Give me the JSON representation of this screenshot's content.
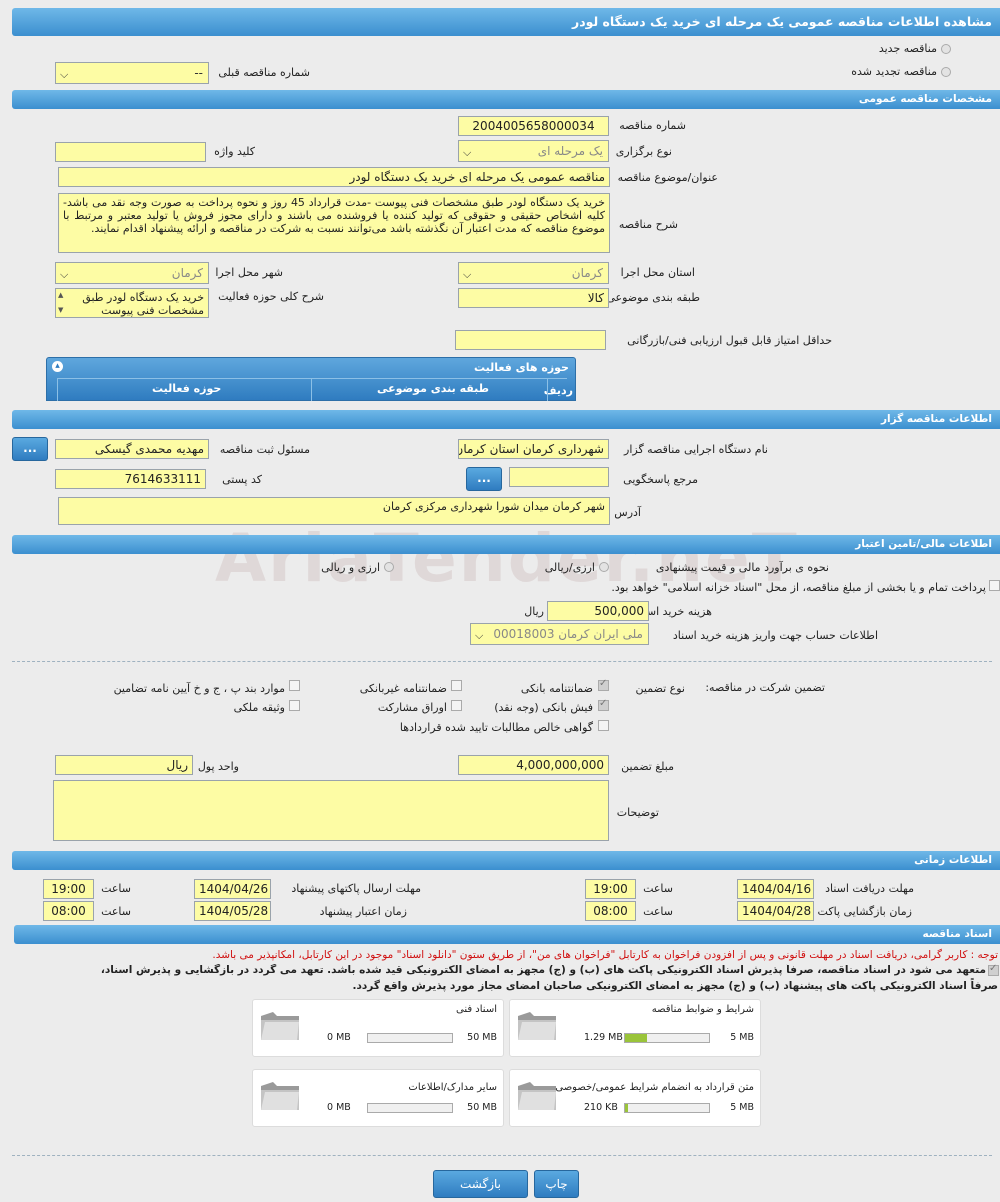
{
  "page": {
    "title": "مشاهده اطلاعات مناقصه عمومی یک مرحله ای خرید یک دستگاه لودر"
  },
  "top": {
    "new_tender": "مناقصه جدید",
    "renewed_tender": "مناقصه تجدید شده",
    "prev_number_label": "شماره مناقصه قبلی",
    "prev_number_value": "--"
  },
  "general": {
    "section": "مشخصات مناقصه عمومی",
    "number_label": "شماره مناقصه",
    "number_value": "2004005658000034",
    "type_label": "نوع برگزاری",
    "type_value": "یک مرحله ای",
    "keyword_label": "کلید واژه",
    "keyword_value": "",
    "subject_label": "عنوان/موضوع مناقصه",
    "subject_value": "مناقصه عمومی یک مرحله ای خرید یک دستگاه لودر",
    "desc_label": "شرح مناقصه",
    "desc_value": "خرید یک دستگاه لودر طبق مشخصات فنی پیوست -مدت قرارداد  45 روز  و نحوه پرداخت به صورت وجه نقد می باشد-کلیه اشخاص حقیقی و حقوقی که تولید کننده یا فروشنده می باشند و دارای مجوز فروش یا تولید معتبر و مرتبط با موضوع مناقصه که مدت اعتبار آن نگذشته باشد می‌توانند نسبت به شرکت در مناقصه و ارائه پیشنهاد اقدام نمایند.",
    "province_label": "استان محل اجرا",
    "province_value": "کرمان",
    "city_label": "شهر محل اجرا",
    "city_value": "کرمان",
    "category_label": "طبقه بندی موضوعی",
    "category_value": "کالا",
    "activity_desc_label": "شرح کلی حوزه فعالیت",
    "activity_desc_value": "خرید یک دستگاه لودر طبق مشخصات فنی پیوست",
    "min_score_label": "حداقل امتیاز قابل قبول ارزیابی فنی/بازرگانی",
    "min_score_value": ""
  },
  "activities": {
    "title": "حوزه های فعالیت",
    "col_row": "ردیف",
    "col_category": "طبقه بندی موضوعی",
    "col_activity": "حوزه فعالیت"
  },
  "organizer": {
    "section": "اطلاعات مناقصه گزار",
    "org_label": "نام دستگاه اجرایی مناقصه گزار",
    "org_value": "شهرداری کرمان استان کرمان",
    "resp_label": "مسئول ثبت مناقصه",
    "resp_value": "مهدیه محمدی گیسکی",
    "ref_label": "مرجع پاسخگویی",
    "ref_value": "",
    "postal_label": "کد پستی",
    "postal_value": "7614633111",
    "address_label": "آدرس",
    "address_value": "شهر کرمان میدان شورا شهرداری مرکزی کرمان",
    "dots": "..."
  },
  "financial": {
    "section": "اطلاعات مالی/تامین اعتبار",
    "estimate_label": "نحوه ی برآورد مالی و قیمت پیشنهادی",
    "opt_currency": "ارزی/ریالی",
    "opt_rial": "ارزی و ریالی",
    "treasury_label": "پرداخت تمام و یا بخشی از مبلغ مناقصه، از محل \"اسناد خزانه اسلامی\" خواهد بود.",
    "doc_cost_label": "هزینه خرید اسناد",
    "doc_cost_value": "500,000",
    "doc_cost_unit": "ریال",
    "account_label": "اطلاعات حساب جهت واریز هزینه خرید اسناد",
    "account_value": "ملی ایران کرمان 00018003"
  },
  "guarantee": {
    "title": "تضمین شرکت در مناقصه:",
    "type_label": "نوع تضمین",
    "bank": "ضمانتنامه بانکی",
    "nonbank": "ضمانتنامه غیربانکی",
    "clauses": "موارد بند پ ، ج و خ آیین نامه تضامین",
    "cash": "فیش بانکی (وجه نقد)",
    "bonds": "اوراق مشارکت",
    "property": "وثیقه ملکی",
    "claims": "گواهی خالص مطالبات تایید شده قراردادها",
    "amount_label": "مبلغ تضمین",
    "amount_value": "4,000,000,000",
    "unit_label": "واحد پول",
    "unit_value": "ریال",
    "notes_label": "توضیحات",
    "notes_value": ""
  },
  "timing": {
    "section": "اطلاعات زمانی",
    "receive_label": "مهلت دریافت اسناد",
    "receive_date": "1404/04/16",
    "receive_time": "19:00",
    "send_label": "مهلت ارسال پاکتهای پیشنهاد",
    "send_date": "1404/04/26",
    "send_time": "19:00",
    "open_label": "زمان بازگشایی پاکت ها",
    "open_date": "1404/04/28",
    "open_time": "08:00",
    "validity_label": "زمان اعتبار پیشنهاد",
    "validity_date": "1404/05/28",
    "validity_time": "08:00",
    "time_label": "ساعت"
  },
  "docs": {
    "section": "اسناد مناقصه",
    "warning": "توجه : کاربر گرامی، دریافت اسناد در مهلت قانونی و پس از افزودن فراخوان به کارتابل \"فراخوان های من\"، از طریق ستون \"دانلود اسناد\" موجود در این کارتابل، امکانپذیر می باشد.",
    "commit_line1": "متعهد می شود در اسناد مناقصه، صرفاً پذیرش اسناد الکترونیکی پاکت های (ب) و (ج) مجهز به امضای الکترونیکی قید شده باشد. تعهد می گردد در بازگشایی و پذیرش اسناد،",
    "commit_line2": "صرفاً اسناد الکترونیکی پاکت های پیشنهاد (ب) و (ج) مجهز به امضای الکترونیکی صاحبان امضای مجاز مورد پذیرش واقع گردد.",
    "items": [
      {
        "name": "شرایط و ضوابط مناقصه",
        "size": "1.29 MB",
        "max": "5 MB",
        "fill": 0.26
      },
      {
        "name": "اسناد فنی",
        "size": "0 MB",
        "max": "50 MB",
        "fill": 0
      },
      {
        "name": "متن قرارداد به انضمام شرایط عمومی/خصوصی",
        "size": "210 KB",
        "max": "5 MB",
        "fill": 0.04
      },
      {
        "name": "سایر مدارک/اطلاعات",
        "size": "0 MB",
        "max": "50 MB",
        "fill": 0
      }
    ]
  },
  "footer": {
    "print": "چاپ",
    "back": "بازگشت"
  },
  "watermark": "AriaTender.neT",
  "colors": {
    "header": "#3b8fcf",
    "field": "#fdfca4",
    "progress": "#9ac43a"
  }
}
